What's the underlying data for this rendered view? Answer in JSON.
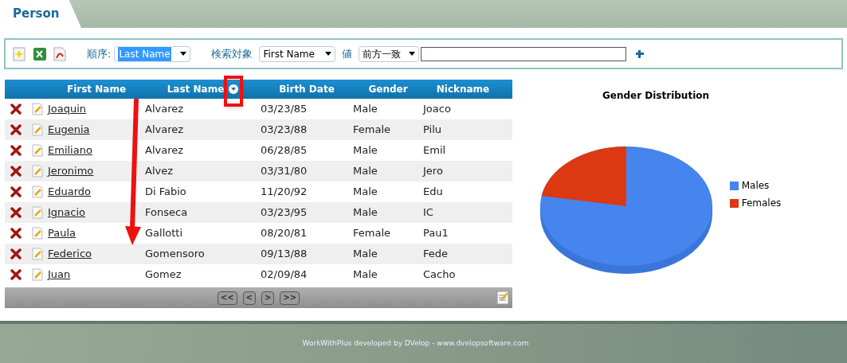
{
  "tab": {
    "label": "Person",
    "selected": true
  },
  "toolbar": {
    "order_label": "順序:",
    "order_value": "Last Name",
    "order_focused": true,
    "search_label": "検索対象",
    "search_field": "First Name",
    "value_label": "値",
    "match_mode": "前方一致"
  },
  "table": {
    "columns": [
      {
        "label": "First Name",
        "sorted": false
      },
      {
        "label": "Last Name",
        "sorted": true
      },
      {
        "label": "Birth Date",
        "sorted": false
      },
      {
        "label": "Gender",
        "sorted": false
      },
      {
        "label": "Nickname",
        "sorted": false
      }
    ],
    "rows": [
      {
        "first_name": "Joaquin",
        "last_name": "Alvarez",
        "birth_date": "03/23/85",
        "gender": "Male",
        "nickname": "Joaco"
      },
      {
        "first_name": "Eugenia",
        "last_name": "Alvarez",
        "birth_date": "03/23/88",
        "gender": "Female",
        "nickname": "Pilu"
      },
      {
        "first_name": "Emiliano",
        "last_name": "Alvarez",
        "birth_date": "06/28/85",
        "gender": "Male",
        "nickname": "Emil"
      },
      {
        "first_name": "Jeronimo",
        "last_name": "Alvez",
        "birth_date": "03/31/80",
        "gender": "Male",
        "nickname": "Jero"
      },
      {
        "first_name": "Eduardo",
        "last_name": "Di Fabio",
        "birth_date": "11/20/92",
        "gender": "Male",
        "nickname": "Edu"
      },
      {
        "first_name": "Ignacio",
        "last_name": "Fonseca",
        "birth_date": "03/23/95",
        "gender": "Male",
        "nickname": "IC"
      },
      {
        "first_name": "Paula",
        "last_name": "Gallotti",
        "birth_date": "08/20/81",
        "gender": "Female",
        "nickname": "Pau1"
      },
      {
        "first_name": "Federico",
        "last_name": "Gomensoro",
        "birth_date": "09/13/88",
        "gender": "Male",
        "nickname": "Fede"
      },
      {
        "first_name": "Juan",
        "last_name": "Gomez",
        "birth_date": "02/09/84",
        "gender": "Male",
        "nickname": "Cacho"
      }
    ],
    "pager": [
      "<<",
      "<",
      ">",
      ">>"
    ]
  },
  "chart": {
    "title": "Gender Distribution",
    "legend": [
      {
        "label": "Males",
        "color": "#4684ee"
      },
      {
        "label": "Females",
        "color": "#dc3912"
      }
    ]
  },
  "footer": "WorkWithPlus developed by DVelop - www.dvelopsoftware.com"
}
